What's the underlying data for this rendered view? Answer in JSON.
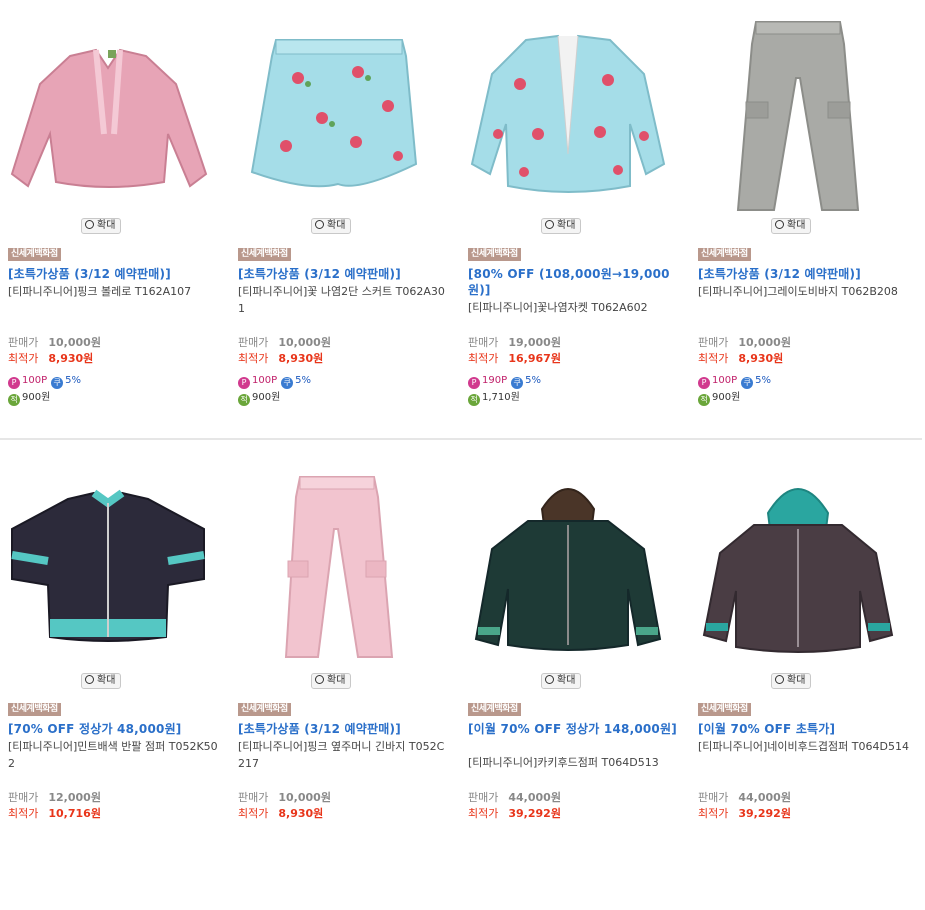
{
  "zoom_label": "확대",
  "badge_label": "신세계백화점",
  "price_label": "판매가",
  "best_label": "최적가",
  "rows": [
    [
      {
        "promo": "[초특가상품 (3/12 예약판매)]",
        "name": "[티파니주니어]핑크 볼레로 T162A107",
        "price": "10,000원",
        "best": "8,930원",
        "point": "100P",
        "coupon": "5%",
        "save": "900원",
        "icon": "pink-bolero"
      },
      {
        "promo": "[초특가상품 (3/12 예약판매)]",
        "name": "[티파니주니어]꽃 나염2단 스커트 T062A301",
        "price": "10,000원",
        "best": "8,930원",
        "point": "100P",
        "coupon": "5%",
        "save": "900원",
        "icon": "floral-skirt"
      },
      {
        "promo": "[80% OFF (108,000원→19,000원)]",
        "name": "[티파니주니어]꽃나염자켓 T062A602",
        "price": "19,000원",
        "best": "16,967원",
        "point": "190P",
        "coupon": "5%",
        "save": "1,710원",
        "icon": "floral-jacket"
      },
      {
        "promo": "[초특가상품 (3/12 예약판매)]",
        "name": "[티파니주니어]그레이도비바지 T062B208",
        "price": "10,000원",
        "best": "8,930원",
        "point": "100P",
        "coupon": "5%",
        "save": "900원",
        "icon": "gray-pants"
      }
    ],
    [
      {
        "promo": "[70% OFF 정상가 48,000원]",
        "name": "[티파니주니어]민트배색 반팔 점퍼 T052K502",
        "price": "12,000원",
        "best": "10,716원",
        "point": "",
        "coupon": "",
        "save": "",
        "icon": "mint-jumper"
      },
      {
        "promo": "[초특가상품 (3/12 예약판매)]",
        "name": "[티파니주니어]핑크 옆주머니 긴바지 T052C217",
        "price": "10,000원",
        "best": "8,930원",
        "point": "",
        "coupon": "",
        "save": "",
        "icon": "pink-pants"
      },
      {
        "promo": "[이월 70% OFF 정상가 148,000원]",
        "name": "[티파니주니어]카키후드점퍼 T064D513",
        "price": "44,000원",
        "best": "39,292원",
        "point": "",
        "coupon": "",
        "save": "",
        "icon": "khaki-hood"
      },
      {
        "promo": "[이월 70% OFF 초특가]",
        "name": "[티파니주니어]네이비후드겹점퍼 T064D514",
        "price": "44,000원",
        "best": "39,292원",
        "point": "",
        "coupon": "",
        "save": "",
        "icon": "navy-hood"
      }
    ]
  ]
}
